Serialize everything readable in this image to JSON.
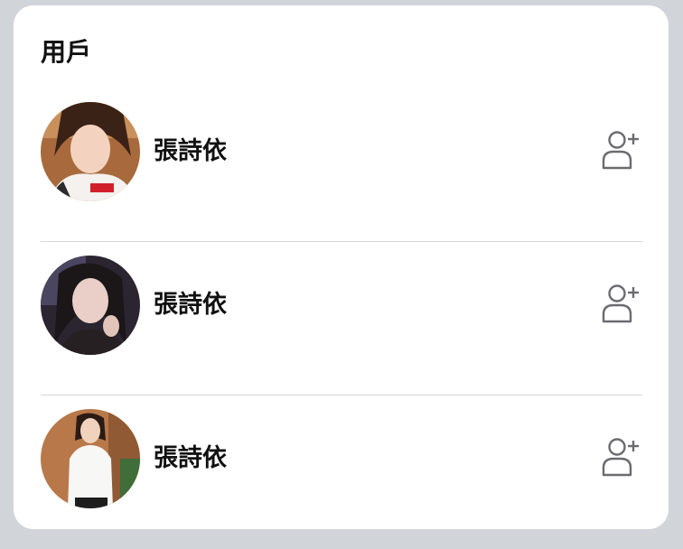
{
  "section": {
    "title": "用戶"
  },
  "users": [
    {
      "name": "張詩依",
      "avatar_icon": "user-photo-avatar",
      "action_icon": "add-friend-icon"
    },
    {
      "name": "張詩依",
      "avatar_icon": "user-photo-avatar",
      "action_icon": "add-friend-icon"
    },
    {
      "name": "張詩依",
      "avatar_icon": "user-photo-avatar",
      "action_icon": "add-friend-icon"
    }
  ],
  "colors": {
    "background": "#d1d4d9",
    "card": "#ffffff",
    "text": "#111111",
    "divider": "#d6d6d8",
    "icon": "#6b6b70"
  }
}
